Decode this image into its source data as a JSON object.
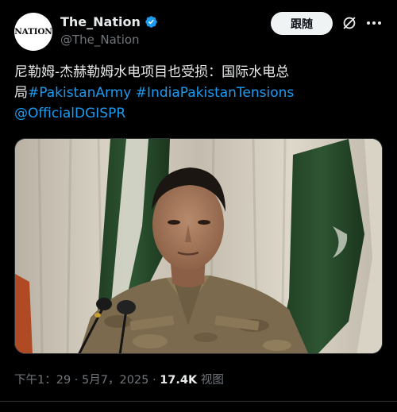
{
  "account": {
    "avatar_text": "NATION",
    "display_name": "The_Nation",
    "handle": "@The_Nation",
    "verified": true
  },
  "actions": {
    "follow_label": "跟随"
  },
  "tweet": {
    "text_line1": "尼勒姆-杰赫勒姆水电项目也受损：国际水电总",
    "text_line2_prefix": "局",
    "hashtag1": "#PakistanArmy",
    "hashtag2": "#IndiaPakistanTensions",
    "mention": "@OfficialDGISPR"
  },
  "meta": {
    "time": "下午1：29",
    "separator1": " · ",
    "date": "5月7，2025",
    "separator2": " · ",
    "views": "17.4K",
    "views_label": "视图"
  },
  "colors": {
    "background": "#000000",
    "link": "#1d9bf0",
    "verified": "#1d9bf0",
    "secondary_text": "#71767b"
  }
}
